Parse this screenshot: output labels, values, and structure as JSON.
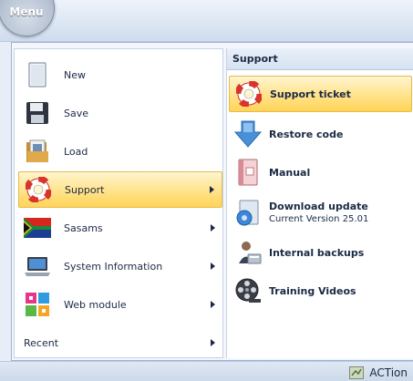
{
  "menu_button": {
    "label": "Menu"
  },
  "left_menu": {
    "items": [
      {
        "label": "New",
        "icon": "new-document-icon",
        "has_submenu": false
      },
      {
        "label": "Save",
        "icon": "floppy-disk-icon",
        "has_submenu": false
      },
      {
        "label": "Load",
        "icon": "folder-load-icon",
        "has_submenu": false
      },
      {
        "label": "Support",
        "icon": "lifebuoy-icon",
        "has_submenu": true,
        "selected": true
      },
      {
        "label": "Sasams",
        "icon": "south-africa-flag-icon",
        "has_submenu": true
      },
      {
        "label": "System Information",
        "icon": "laptop-icon",
        "has_submenu": true
      },
      {
        "label": "Web module",
        "icon": "colored-tiles-icon",
        "has_submenu": true
      },
      {
        "label": "Recent",
        "icon": "",
        "has_submenu": true
      }
    ]
  },
  "submenu": {
    "header": "Support",
    "items": [
      {
        "title": "Support ticket",
        "icon": "lifebuoy-icon",
        "highlighted": true
      },
      {
        "title": "Restore code",
        "icon": "down-arrow-icon"
      },
      {
        "title": "Manual",
        "icon": "manual-book-icon"
      },
      {
        "title": "Download update",
        "subtitle": "Current Version 25.01",
        "icon": "download-update-icon"
      },
      {
        "title": "Internal backups",
        "icon": "backup-person-icon"
      },
      {
        "title": "Training Videos",
        "icon": "film-reel-icon"
      }
    ]
  },
  "status_bar": {
    "action_label": "ACTion"
  },
  "colors": {
    "highlight": "#ffe28a",
    "highlight_border": "#e7b94a",
    "text": "#1b2a44",
    "frame": "#9fb3cf"
  }
}
